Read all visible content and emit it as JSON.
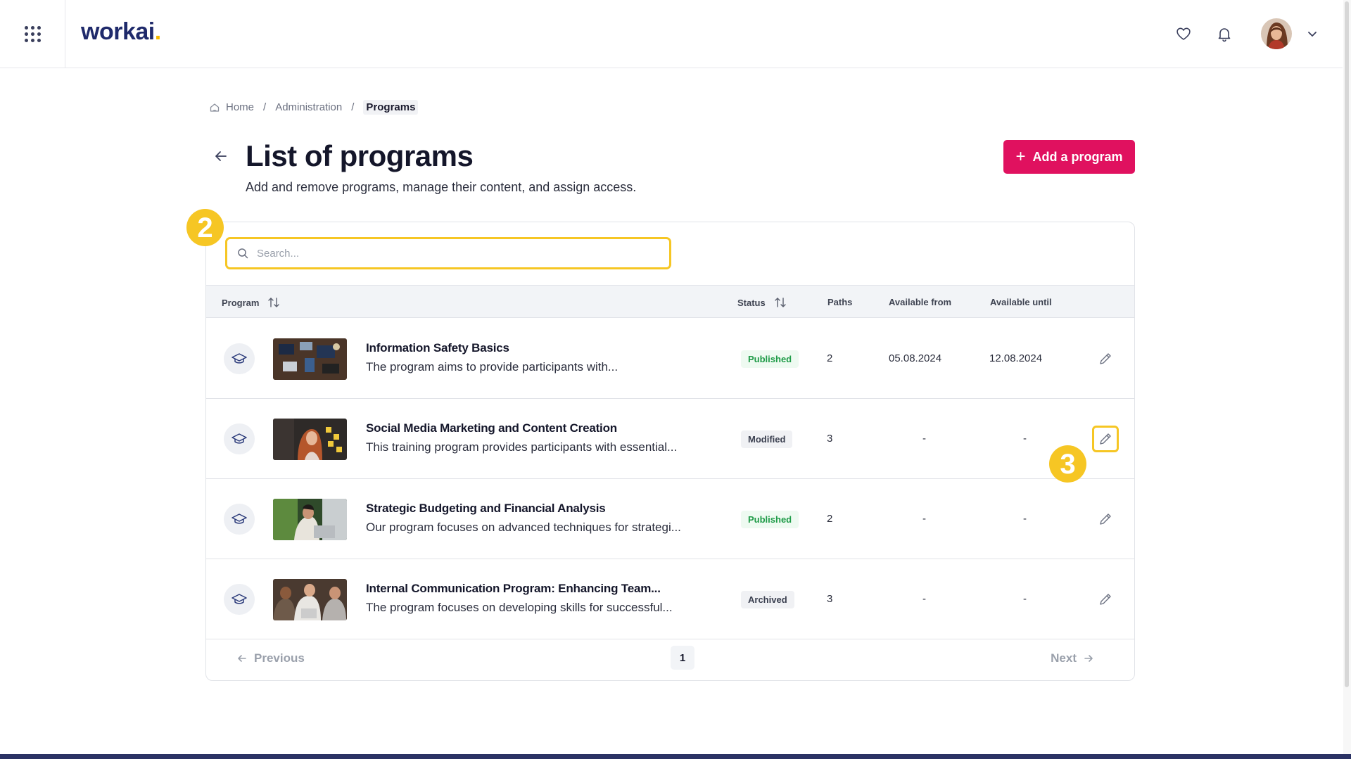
{
  "app": {
    "logo_text": "workai",
    "logo_dot": "."
  },
  "breadcrumb": {
    "home": "Home",
    "admin": "Administration",
    "current": "Programs",
    "separator": "/"
  },
  "page": {
    "title": "List of programs",
    "subtitle": "Add and remove programs, manage their content, and assign access.",
    "add_button": "Add a program"
  },
  "search": {
    "placeholder": "Search..."
  },
  "table": {
    "columns": {
      "program": "Program",
      "status": "Status",
      "paths": "Paths",
      "available_from": "Available from",
      "available_until": "Available until"
    },
    "rows": [
      {
        "title": "Information Safety Basics",
        "description": "The program aims to provide participants with...",
        "status": "Published",
        "paths": "2",
        "available_from": "05.08.2024",
        "available_until": "12.08.2024"
      },
      {
        "title": "Social Media Marketing and Content Creation",
        "description": "This training program provides participants with essential...",
        "status": "Modified",
        "paths": "3",
        "available_from": "-",
        "available_until": "-"
      },
      {
        "title": "Strategic Budgeting and Financial Analysis",
        "description": "Our program focuses on advanced techniques for strategi...",
        "status": "Published",
        "paths": "2",
        "available_from": "-",
        "available_until": "-"
      },
      {
        "title": "Internal Communication Program: Enhancing Team...",
        "description": "The program focuses on developing skills for successful...",
        "status": "Archived",
        "paths": "3",
        "available_from": "-",
        "available_until": "-"
      }
    ]
  },
  "pagination": {
    "previous": "Previous",
    "next": "Next",
    "current_page": "1"
  },
  "annotations": {
    "step_search": "2",
    "step_edit": "3"
  },
  "colors": {
    "accent": "#e0115f",
    "highlight": "#f6c624",
    "brand": "#1f2a6b",
    "published": "#1e9b47"
  }
}
